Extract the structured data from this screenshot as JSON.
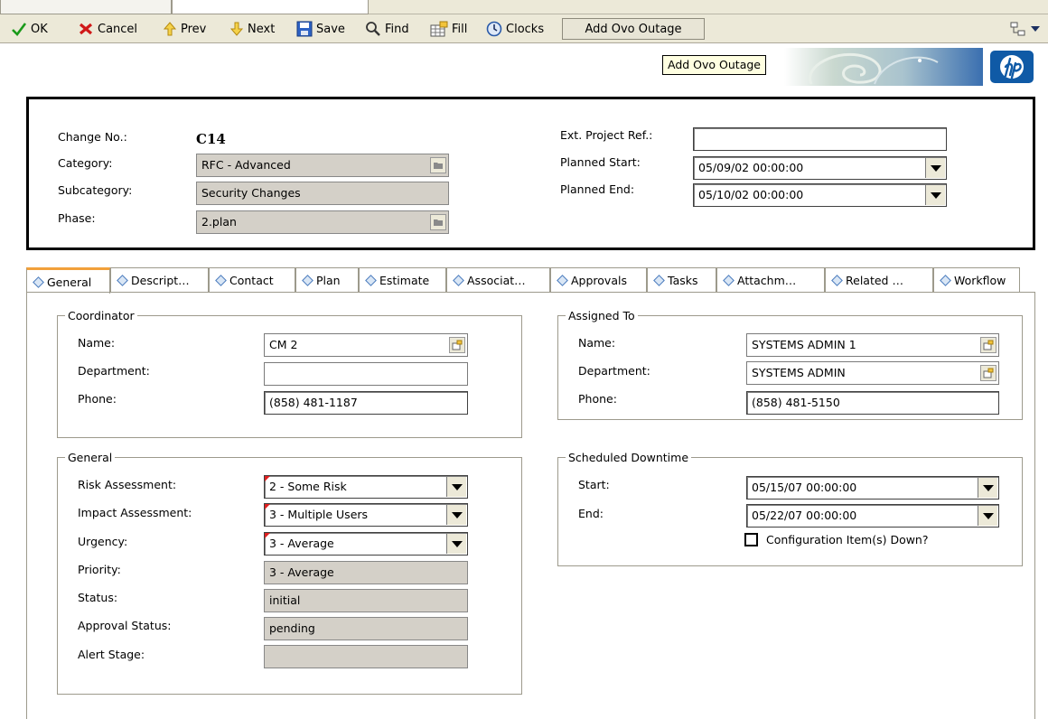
{
  "toolbar": {
    "ok": "OK",
    "cancel": "Cancel",
    "prev": "Prev",
    "next": "Next",
    "save": "Save",
    "find": "Find",
    "fill": "Fill",
    "clocks": "Clocks",
    "add_outage": "Add Ovo Outage"
  },
  "tooltip": "Add Ovo Outage",
  "header": {
    "change_no_label": "Change No.:",
    "change_no": "C14",
    "category_label": "Category:",
    "category": "RFC - Advanced",
    "subcategory_label": "Subcategory:",
    "subcategory": "Security Changes",
    "phase_label": "Phase:",
    "phase": "2.plan",
    "ext_ref_label": "Ext. Project Ref.:",
    "ext_ref": "",
    "planned_start_label": "Planned Start:",
    "planned_start": "05/09/02 00:00:00",
    "planned_end_label": "Planned End:",
    "planned_end": "05/10/02 00:00:00"
  },
  "tabs": [
    "General",
    "Descript…",
    "Contact",
    "Plan",
    "Estimate",
    "Associat…",
    "Approvals",
    "Tasks",
    "Attachm…",
    "Related …",
    "Workflow"
  ],
  "coordinator": {
    "legend": "Coordinator",
    "name_label": "Name:",
    "name": "CM 2",
    "dept_label": "Department:",
    "dept": "",
    "phone_label": "Phone:",
    "phone": "(858) 481-1187"
  },
  "assigned": {
    "legend": "Assigned To",
    "name_label": "Name:",
    "name": "SYSTEMS ADMIN 1",
    "dept_label": "Department:",
    "dept": "SYSTEMS ADMIN",
    "phone_label": "Phone:",
    "phone": "(858) 481-5150"
  },
  "general": {
    "legend": "General",
    "risk_label": "Risk Assessment:",
    "risk": "2 - Some Risk",
    "impact_label": "Impact Assessment:",
    "impact": "3 - Multiple Users",
    "urgency_label": "Urgency:",
    "urgency": "3 - Average",
    "priority_label": "Priority:",
    "priority": "3 - Average",
    "status_label": "Status:",
    "status": "initial",
    "approval_label": "Approval Status:",
    "approval": "pending",
    "alert_label": "Alert Stage:",
    "alert": ""
  },
  "downtime": {
    "legend": "Scheduled Downtime",
    "start_label": "Start:",
    "start": "05/15/07 00:00:00",
    "end_label": "End:",
    "end": "05/22/07 00:00:00",
    "ci_down_label": "Configuration Item(s) Down?",
    "ci_down": false
  },
  "colors": {
    "toolbar_bg": "#ece9d8",
    "readonly_bg": "#d4d0c8",
    "active_tab_accent": "#f2a03b",
    "hp_blue": "#0f5aa6",
    "tooltip_bg": "#ffffe1"
  }
}
